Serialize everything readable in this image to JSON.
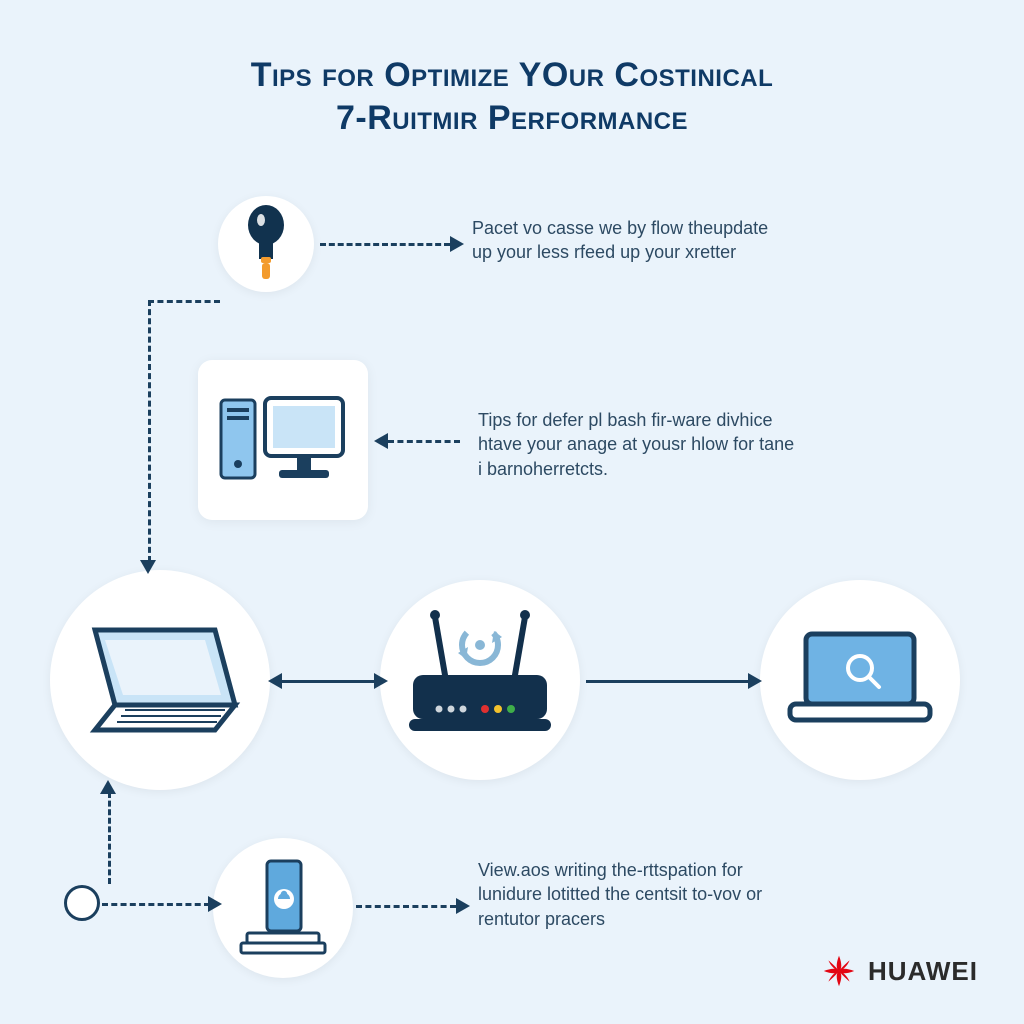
{
  "title": {
    "line1": "Tips for Optimize YOur Costinical",
    "line2": "7-Ruitmir Performance"
  },
  "tips": {
    "bulb": "Pacet vo casse we by flow theupdate up your less rfeed up your xretter",
    "computer": "Tips for defer pl bash fir-ware divhice htave your anage at yousr hlow for tane i barnoherretcts.",
    "phone": "View.aos writing the-rttspation for lunidure lotitted the centsit to-vov or rentutor pracers"
  },
  "brand": "HUAWEI",
  "colors": {
    "bg": "#eaf3fb",
    "ink": "#1b3f5e",
    "accent": "#0f3a66",
    "red": "#e30613",
    "lightblue": "#8fc6ee",
    "orange": "#f39b2d"
  }
}
